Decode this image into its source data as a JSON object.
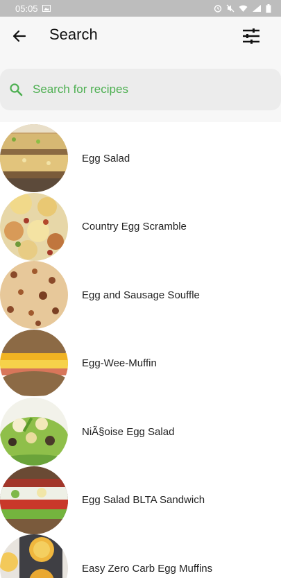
{
  "status_bar": {
    "time": "05:05"
  },
  "header": {
    "title": "Search"
  },
  "search": {
    "placeholder": "Search for recipes",
    "value": ""
  },
  "recipes": [
    {
      "name": "Egg Salad"
    },
    {
      "name": "Country Egg Scramble"
    },
    {
      "name": "Egg and Sausage Souffle"
    },
    {
      "name": "Egg-Wee-Muffin"
    },
    {
      "name": "NiÃ§oise Egg Salad"
    },
    {
      "name": "Egg Salad BLTA Sandwich"
    },
    {
      "name": "Easy Zero Carb Egg Muffins"
    }
  ],
  "icons": {
    "back": "arrow-left-icon",
    "filter": "sliders-icon",
    "search": "search-icon"
  },
  "colors": {
    "accent": "#4caf50",
    "status_bar": "#bdbdbd",
    "header_bg": "#f7f7f7",
    "search_bg": "#ececec"
  }
}
